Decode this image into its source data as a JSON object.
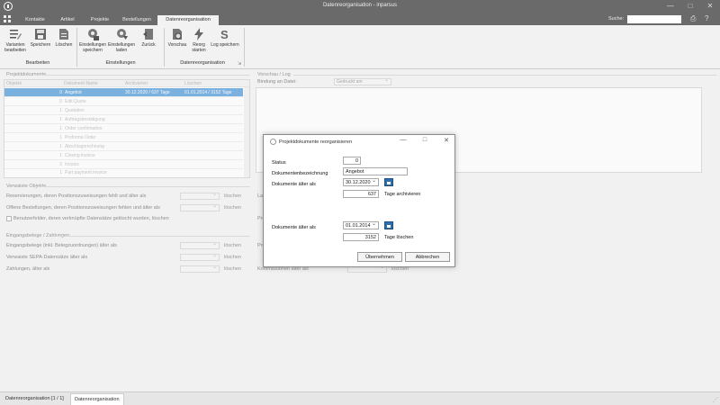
{
  "window": {
    "title": "Datenreorganisation - inparsus",
    "controls": [
      "—",
      "□",
      "✕"
    ]
  },
  "menubar": {
    "tabs": [
      "Kontakte",
      "Artikel",
      "Projekte",
      "Bestellungen",
      "Datenreorganisation"
    ],
    "active_tab": "Datenreorganisation",
    "search_label": "Suche:",
    "search_placeholder": ""
  },
  "ribbon": {
    "groups": [
      {
        "label": "Bearbeiten",
        "buttons": [
          {
            "label": "Varianten bearbeiten",
            "icon": "edit-list-icon"
          },
          {
            "label": "Speichern",
            "icon": "save-icon"
          },
          {
            "label": "Löschen",
            "icon": "delete-icon"
          }
        ]
      },
      {
        "label": "Einstellungen",
        "buttons": [
          {
            "label": "Einstellungen speichern",
            "icon": "settings-save-icon"
          },
          {
            "label": "Einstellungen laden",
            "icon": "settings-load-icon"
          },
          {
            "label": "Zurück",
            "icon": "back-icon"
          }
        ]
      },
      {
        "label": "Datenreorganisation",
        "buttons": [
          {
            "label": "Vorschau",
            "icon": "preview-icon"
          },
          {
            "label": "Reorg starten",
            "icon": "lightning-icon"
          },
          {
            "label": "Log speichern",
            "icon": "log-save-icon"
          }
        ]
      }
    ]
  },
  "left_panel": {
    "title": "Projektdokumente",
    "columns": [
      "Objekte",
      "Dokument-Name",
      "Archivieren",
      "Löschen"
    ],
    "rows": [
      {
        "count": "0",
        "name": "Angebot",
        "archive": "30.12.2020 / 637 Tage",
        "delete": "01.01.2014 / 3152 Tage",
        "selected": true
      },
      {
        "count": "0",
        "name": "Edit Quote",
        "archive": "",
        "delete": "",
        "selected": false
      },
      {
        "count": "1",
        "name": "Quotation",
        "archive": "",
        "delete": "",
        "selected": false
      },
      {
        "count": "1",
        "name": "Auftragsbestätigung",
        "archive": "",
        "delete": "",
        "selected": false
      },
      {
        "count": "1",
        "name": "Order confirmation",
        "archive": "",
        "delete": "",
        "selected": false
      },
      {
        "count": "1",
        "name": "Proforma Order",
        "archive": "",
        "delete": "",
        "selected": false
      },
      {
        "count": "1",
        "name": "Abschlagsrechnung",
        "archive": "",
        "delete": "",
        "selected": false
      },
      {
        "count": "1",
        "name": "Closing invoice",
        "archive": "",
        "delete": "",
        "selected": false
      },
      {
        "count": "2",
        "name": "Invoice",
        "archive": "",
        "delete": "",
        "selected": false
      },
      {
        "count": "1",
        "name": "Part payment invoice",
        "archive": "",
        "delete": "",
        "selected": false
      }
    ]
  },
  "orphaned": {
    "title": "Verwaiste Objekte",
    "rows": [
      {
        "label": "Reservierungen, deren Positionszuweisungen fehlt und älter als",
        "action": "löschen"
      },
      {
        "label": "Offene Bestellungen, deren Positionszuweisungen fehlen und älter als",
        "action": "löschen"
      }
    ],
    "checkbox_label": "Benutzerfelder, deren verknüpfte Datensätze gelöscht wurden, löschen"
  },
  "incoming": {
    "title": "Eingangsbelege / Zahlungen",
    "rows": [
      {
        "label": "Eingangsbelege (inkl. Belegzuordnungen) älter als",
        "action": "löschen"
      },
      {
        "label": "Verwaiste SEPA-Datensätze älter als",
        "action": "löschen"
      },
      {
        "label": "Zahlungen, älter als",
        "action": "löschen"
      }
    ]
  },
  "right_panel": {
    "title": "Vorschau / Log",
    "binding_label": "Bindung an Datei:",
    "binding_value": "Gedruckt am",
    "partial_labels": [
      "Lag",
      "Pro",
      "Pro",
      "Kommissionen älter als",
      "löschen"
    ]
  },
  "dialog": {
    "title": "Projektdokumente reorganisieren",
    "status_label": "Status",
    "status_value": "0",
    "doc_name_label": "Dokumentenbezeichnung",
    "doc_name_value": "Angebot",
    "archive_label": "Dokumente älter als",
    "archive_date": "30.12.2020",
    "archive_days": "637",
    "archive_unit": "Tage archivieren",
    "delete_label": "Dokumente älter als",
    "delete_date": "01.01.2014",
    "delete_days": "3152",
    "delete_unit": "Tage löschen",
    "ok_label": "Übernehmen",
    "cancel_label": "Abbrechen"
  },
  "statusbar": {
    "tabs": [
      "Datenreorganisation [1 / 1]",
      "Datenreorganisation"
    ]
  }
}
